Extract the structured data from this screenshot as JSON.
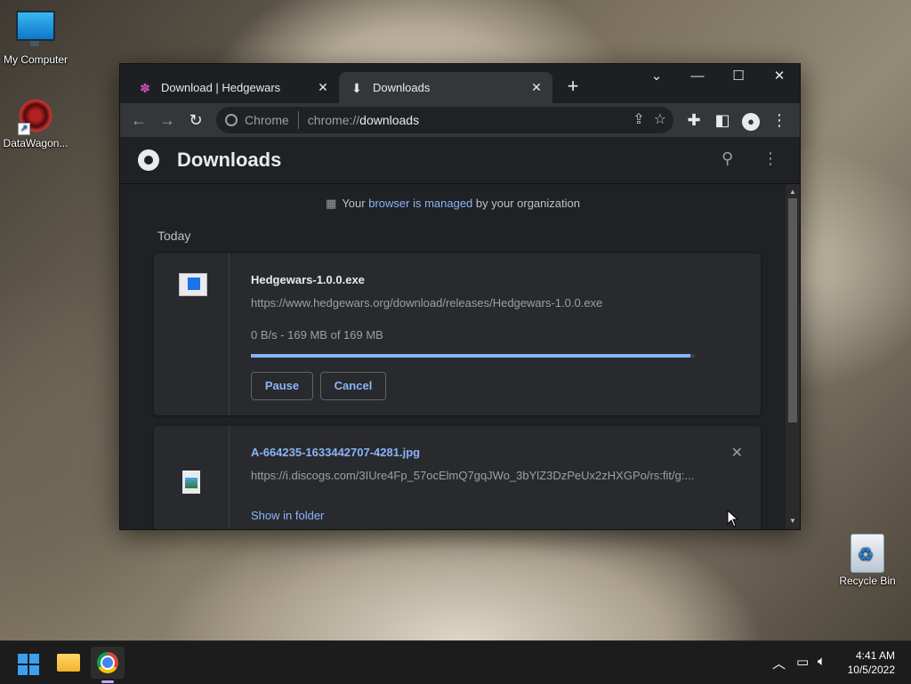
{
  "desktop": {
    "icons": [
      {
        "label": "My Computer"
      },
      {
        "label": "DataWagon..."
      },
      {
        "label": "Recycle Bin"
      }
    ]
  },
  "browser": {
    "tabs": [
      {
        "title": "Download | Hedgewars",
        "favicon": "hedgewars-icon"
      },
      {
        "title": "Downloads",
        "favicon": "download-icon"
      }
    ],
    "omnibox": {
      "site_label": "Chrome",
      "url_prefix": "chrome://",
      "url_path": "downloads"
    },
    "page": {
      "title": "Downloads",
      "managed_notice": {
        "before": "Your ",
        "link": "browser is managed",
        "after": " by your organization"
      },
      "section_label": "Today",
      "downloads": [
        {
          "file_name": "Hedgewars-1.0.0.exe",
          "url": "https://www.hedgewars.org/download/releases/Hedgewars-1.0.0.exe",
          "status": "0 B/s - 169 MB of 169 MB",
          "progress_percent": 99,
          "buttons": {
            "pause": "Pause",
            "cancel": "Cancel"
          }
        },
        {
          "file_name": "A-664235-1633442707-4281.jpg",
          "url": "https://i.discogs.com/3IUre4Fp_57ocElmQ7gqJWo_3bYlZ3DzPeUx2zHXGPo/rs:fit/g:...",
          "action_link": "Show in folder"
        }
      ]
    }
  },
  "taskbar": {
    "time": "4:41 AM",
    "date": "10/5/2022"
  },
  "colors": {
    "accent": "#8ab4f8",
    "page_bg": "#202124",
    "card_bg": "#292a2d"
  }
}
